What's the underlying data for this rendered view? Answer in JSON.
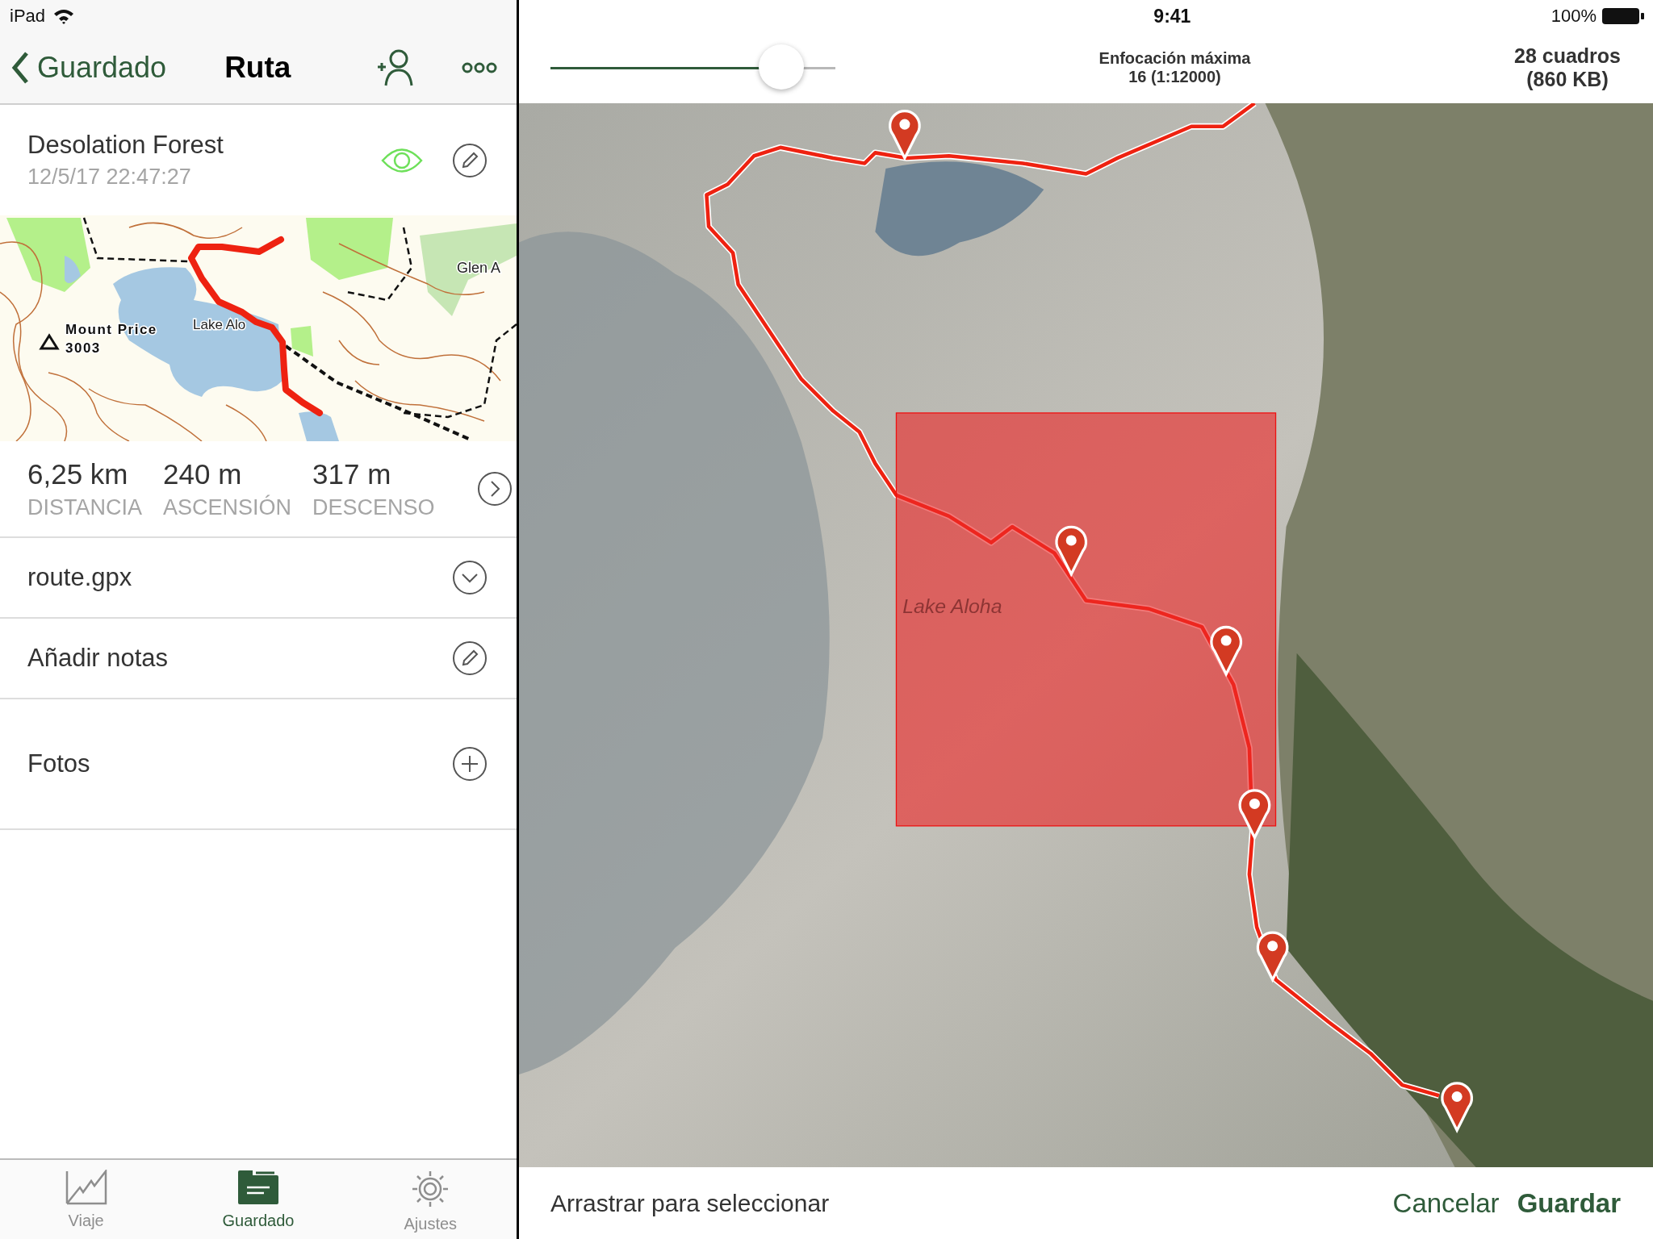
{
  "status_bar": {
    "device": "iPad",
    "time": "9:41",
    "battery": "100%"
  },
  "nav": {
    "back": "Guardado",
    "title": "Ruta"
  },
  "route": {
    "name": "Desolation Forest",
    "date": "12/5/17 22:47:27",
    "visible": true
  },
  "thumbnail_map": {
    "labels": [
      {
        "kind": "peak",
        "text": "Mount Price"
      },
      {
        "kind": "elevation",
        "text": "3003"
      },
      {
        "kind": "lake",
        "text": "Lake Alo"
      },
      {
        "kind": "place",
        "text": "Glen A"
      }
    ]
  },
  "stats": [
    {
      "value": "6,25 km",
      "label": "DISTANCIA"
    },
    {
      "value": "240 m",
      "label": "ASCENSIÓN"
    },
    {
      "value": "317 m",
      "label": "DESCENSO"
    }
  ],
  "rows": [
    {
      "label": "route.gpx",
      "kind": "expand"
    },
    {
      "label": "Añadir notas",
      "kind": "edit"
    },
    {
      "label": "Fotos",
      "kind": "add"
    }
  ],
  "tabs": [
    {
      "label": "Viaje",
      "kind": "trip",
      "selected": false
    },
    {
      "label": "Guardado",
      "kind": "saved",
      "selected": true
    },
    {
      "label": "Ajustes",
      "kind": "settings",
      "selected": false
    }
  ],
  "download": {
    "slider": {
      "level": 0.81
    },
    "zoom_title": "Enfocación máxima",
    "zoom_value": "16 (1:12000)",
    "tiles": "28 cuadros",
    "size": "(860 KB)"
  },
  "map": {
    "label": "Lake Aloha",
    "selection": true
  },
  "footer": {
    "hint": "Arrastrar para seleccionar",
    "buttons": [
      {
        "label": "Cancelar",
        "kind": "secondary"
      },
      {
        "label": "Guardar",
        "kind": "primary"
      }
    ]
  }
}
